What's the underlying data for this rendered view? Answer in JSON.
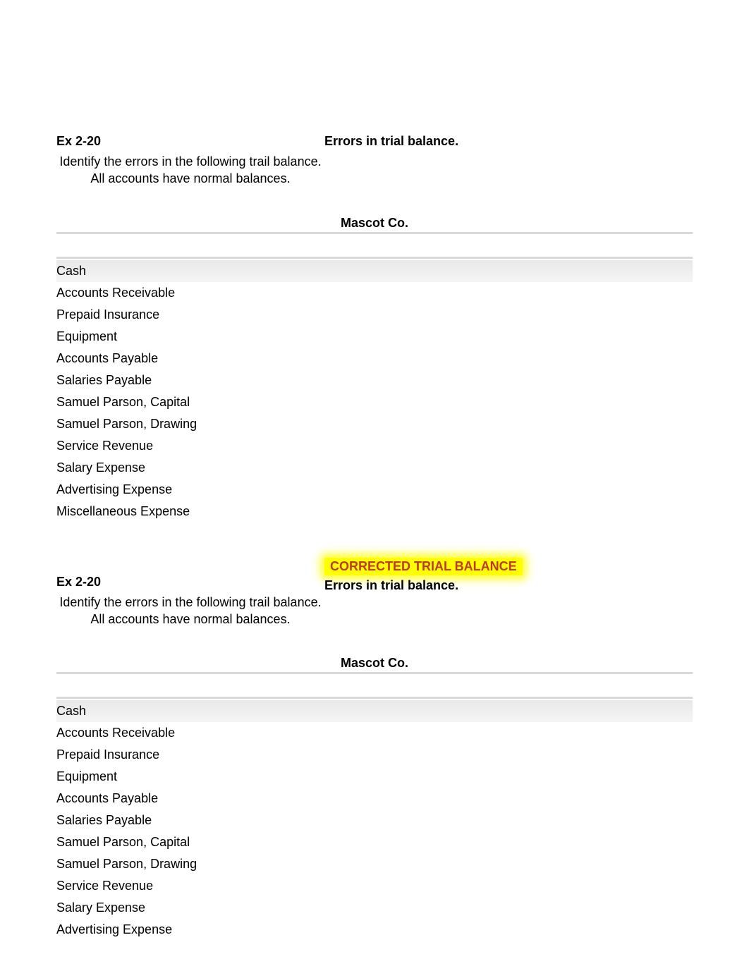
{
  "section1": {
    "exLabel": "Ex 2-20",
    "instruction": "Identify the errors in the following trail balance.  All accounts have normal balances.",
    "errorsTitle": "Errors in trial balance.",
    "company": "Mascot Co.",
    "accounts": [
      "Cash",
      "Accounts Receivable",
      "Prepaid Insurance",
      "Equipment",
      "Accounts Payable",
      "Salaries Payable",
      "Samuel Parson, Capital",
      "Samuel Parson, Drawing",
      "Service Revenue",
      "Salary Expense",
      "Advertising Expense",
      "Miscellaneous Expense"
    ]
  },
  "section2": {
    "correctedBanner": "CORRECTED TRIAL BALANCE",
    "exLabel": "Ex 2-20",
    "instruction": "Identify the errors in the following trail balance.  All accounts have normal balances.",
    "errorsTitle": "Errors in trial balance.",
    "company": "Mascot Co.",
    "accounts": [
      "Cash",
      "Accounts Receivable",
      "Prepaid Insurance",
      "Equipment",
      "Accounts Payable",
      "Salaries Payable",
      "Samuel Parson, Capital",
      "Samuel Parson, Drawing",
      "Service Revenue",
      "Salary Expense",
      "Advertising Expense"
    ]
  }
}
